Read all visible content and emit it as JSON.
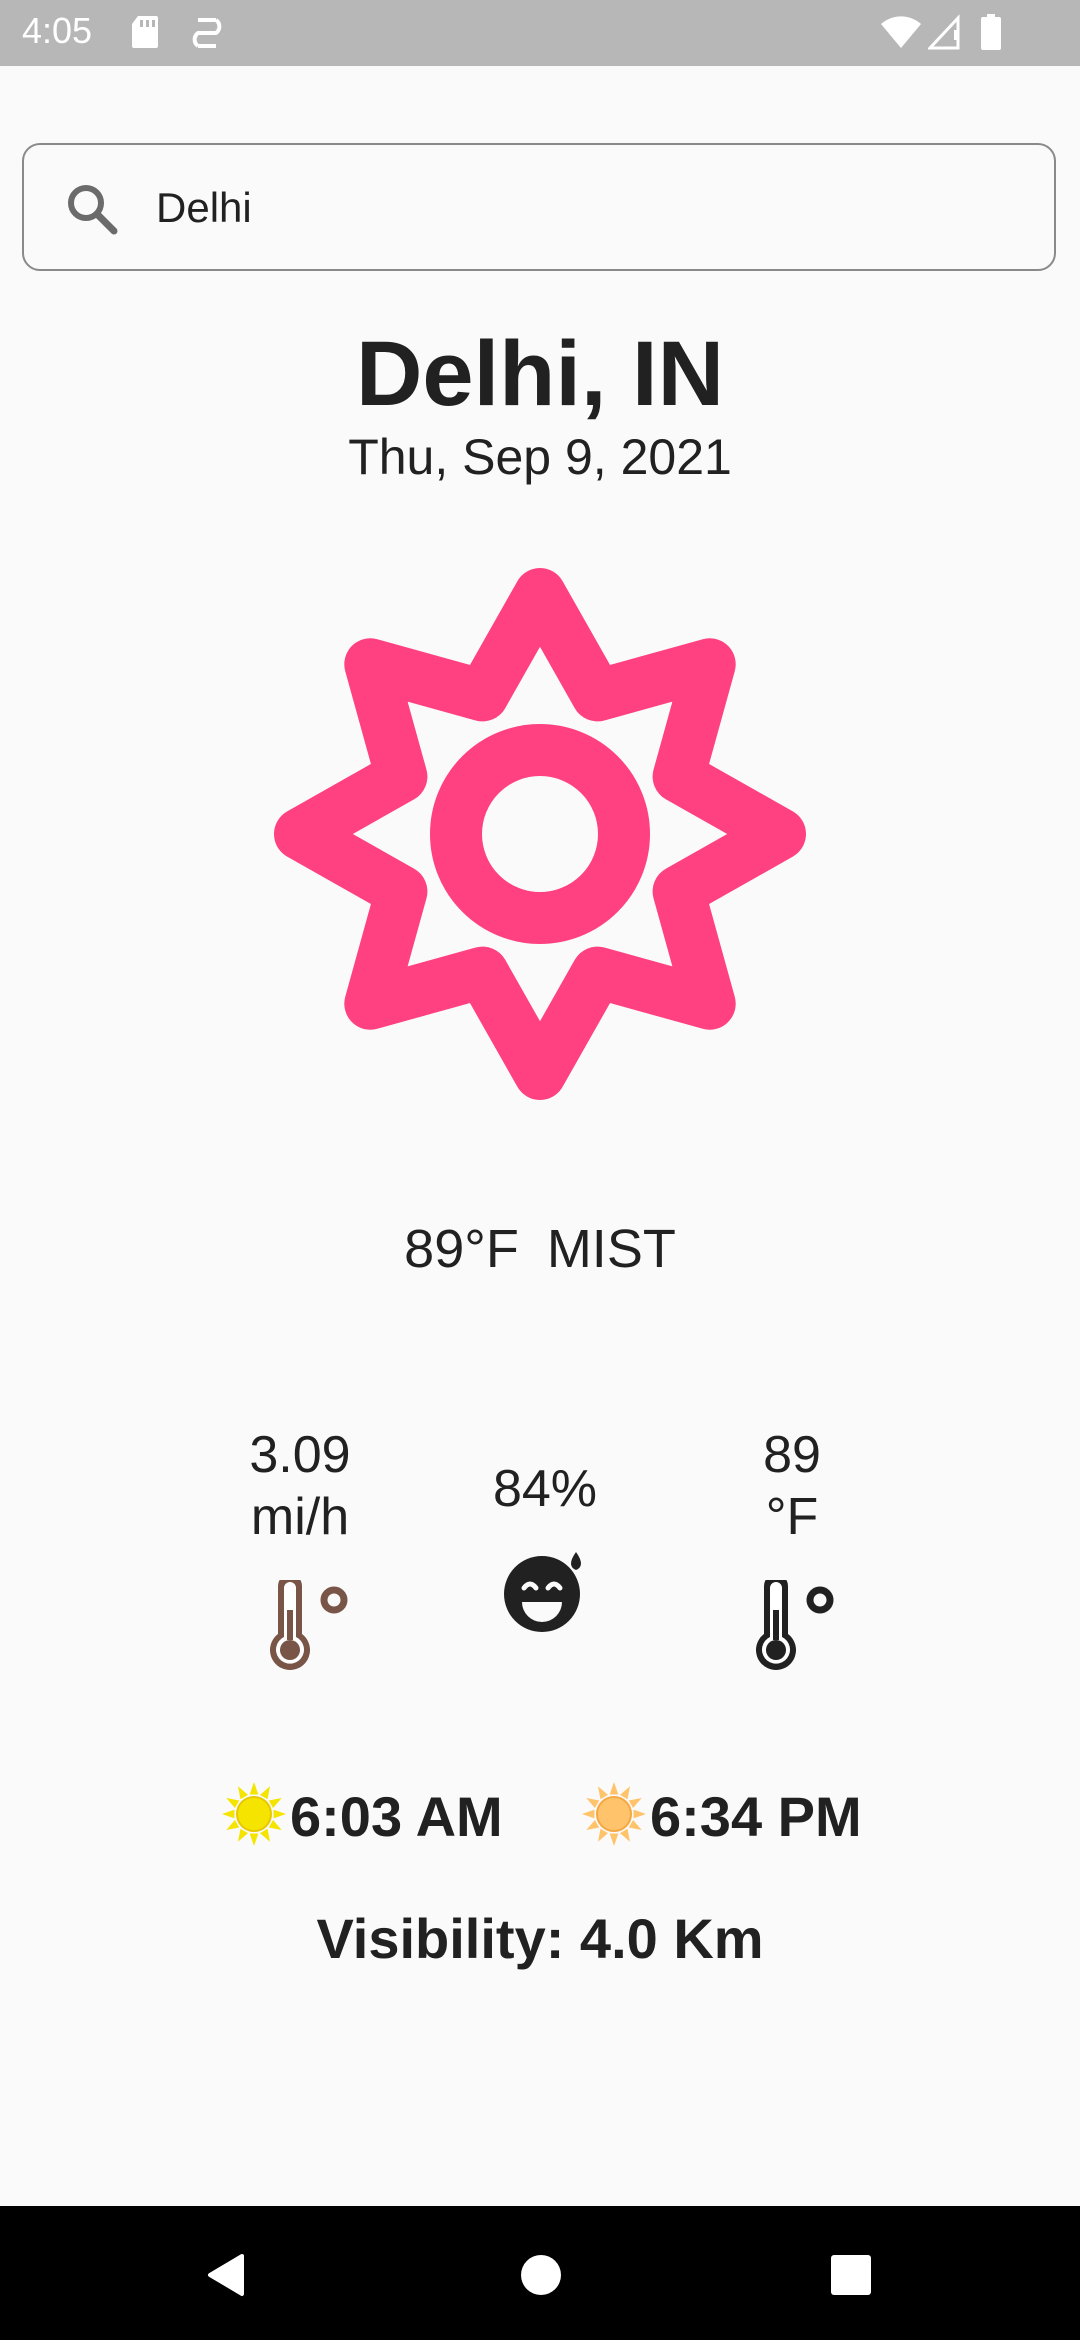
{
  "status_bar": {
    "time": "4:05",
    "icons": [
      "sd-card-icon",
      "sync-icon",
      "wifi-icon",
      "signal-icon",
      "battery-icon"
    ]
  },
  "search": {
    "value": "Delhi",
    "icon": "search-icon"
  },
  "location": {
    "city": "Delhi, IN",
    "date": "Thu, Sep 9, 2021"
  },
  "current": {
    "icon": "sun-icon",
    "icon_color": "#ff4081",
    "temperature": "89°F",
    "description": "MIST"
  },
  "stats": {
    "wind": {
      "value": "3.09",
      "unit": "mi/h",
      "icon": "thermometer-icon"
    },
    "humidity": {
      "value": "84%",
      "icon": "sweat-smile-icon"
    },
    "feels_like": {
      "value": "89",
      "unit": "°F",
      "icon": "thermometer-icon"
    }
  },
  "sun": {
    "sunrise": "6:03 AM",
    "sunset": "6:34 PM"
  },
  "visibility": "Visibility: 4.0 Km",
  "nav": {
    "icons": [
      "back-icon",
      "home-icon",
      "recents-icon"
    ]
  }
}
